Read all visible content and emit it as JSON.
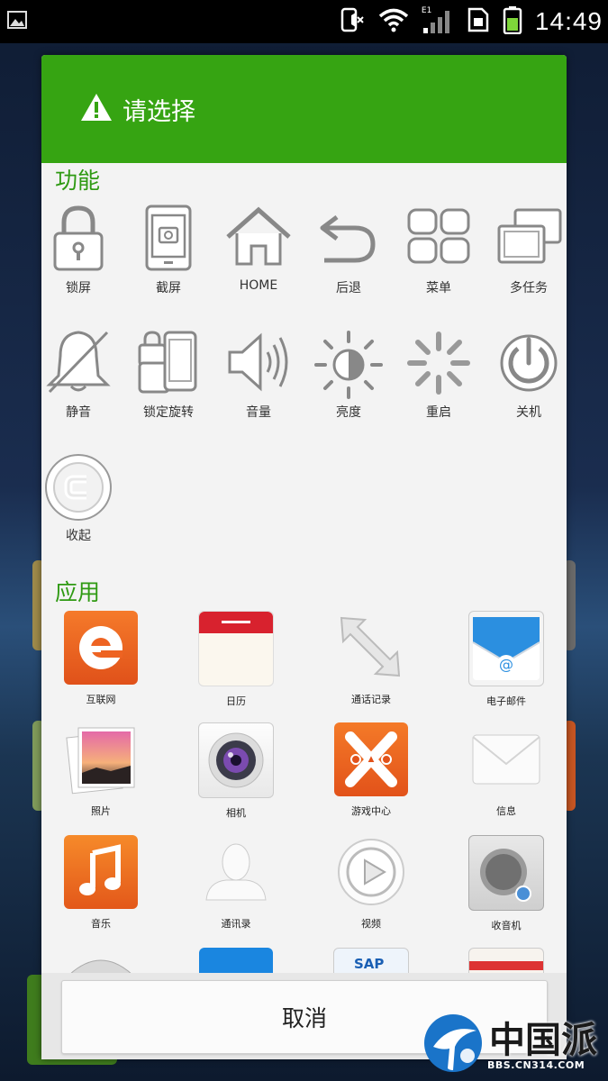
{
  "status_bar": {
    "time": "14:49",
    "network_label": "E1"
  },
  "dialog": {
    "title": "请选择",
    "functions_title": "功能",
    "functions": [
      {
        "label": "锁屏",
        "icon": "lock-icon"
      },
      {
        "label": "截屏",
        "icon": "screenshot-icon"
      },
      {
        "label": "HOME",
        "icon": "home-icon"
      },
      {
        "label": "后退",
        "icon": "back-icon"
      },
      {
        "label": "菜单",
        "icon": "menu-icon"
      },
      {
        "label": "多任务",
        "icon": "multitask-icon"
      },
      {
        "label": "静音",
        "icon": "mute-icon"
      },
      {
        "label": "锁定旋转",
        "icon": "rotation-lock-icon"
      },
      {
        "label": "音量",
        "icon": "volume-icon"
      },
      {
        "label": "亮度",
        "icon": "brightness-icon"
      },
      {
        "label": "重启",
        "icon": "restart-icon"
      },
      {
        "label": "关机",
        "icon": "power-icon"
      },
      {
        "label": "收起",
        "icon": "collapse-icon"
      }
    ],
    "apps_title": "应用",
    "apps": [
      {
        "label": "互联网",
        "icon": "browser-icon"
      },
      {
        "label": "日历",
        "icon": "calendar-icon"
      },
      {
        "label": "通话记录",
        "icon": "call-log-icon"
      },
      {
        "label": "电子邮件",
        "icon": "email-icon"
      },
      {
        "label": "照片",
        "icon": "photos-icon"
      },
      {
        "label": "相机",
        "icon": "camera-icon"
      },
      {
        "label": "游戏中心",
        "icon": "game-center-icon"
      },
      {
        "label": "信息",
        "icon": "messages-icon"
      },
      {
        "label": "音乐",
        "icon": "music-icon"
      },
      {
        "label": "通讯录",
        "icon": "contacts-icon"
      },
      {
        "label": "视频",
        "icon": "video-icon"
      },
      {
        "label": "收音机",
        "icon": "radio-icon"
      }
    ],
    "partial_app_text": "SAP",
    "cancel_label": "取消"
  },
  "watermark": {
    "brand": "中国派",
    "url": "BBS.CN314.COM"
  },
  "colors": {
    "accent": "#36a412",
    "section_title": "#2f9a13"
  }
}
